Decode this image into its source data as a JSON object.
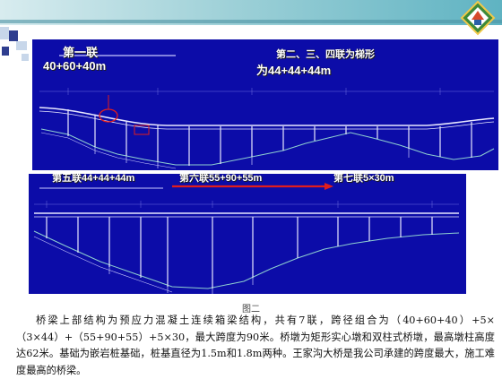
{
  "drawing_top": {
    "label_left_line1": "第一联",
    "label_left_line2": "40+60+40m",
    "label_right_line1": "第二、三、四联为梯形",
    "label_right_line2": "为44+44+44m"
  },
  "drawing_bottom": {
    "label_left": "第五联44+44+44m",
    "label_middle": "第六联55+90+55m",
    "label_right": "第七联5×30m"
  },
  "caption": "图二",
  "paragraph": "桥梁上部结构为预应力混凝土连续箱梁结构，共有7联，跨径组合为（40+60+40）+5×（3×44）+（55+90+55）+5×30，最大跨度为90米。桥墩为矩形实心墩和双柱式桥墩，最高墩柱高度达62米。基础为嵌岩桩基础，桩基直径为1.5m和1.8m两种。王家沟大桥是我公司承建的跨度最大，施工难度最高的桥梁。",
  "colors": {
    "drawing_background": "#0c0ca8",
    "drawing_lines": "#e8e8ff",
    "annotation_red": "#e11d1d",
    "accent_teal": "#5fb3c2"
  }
}
